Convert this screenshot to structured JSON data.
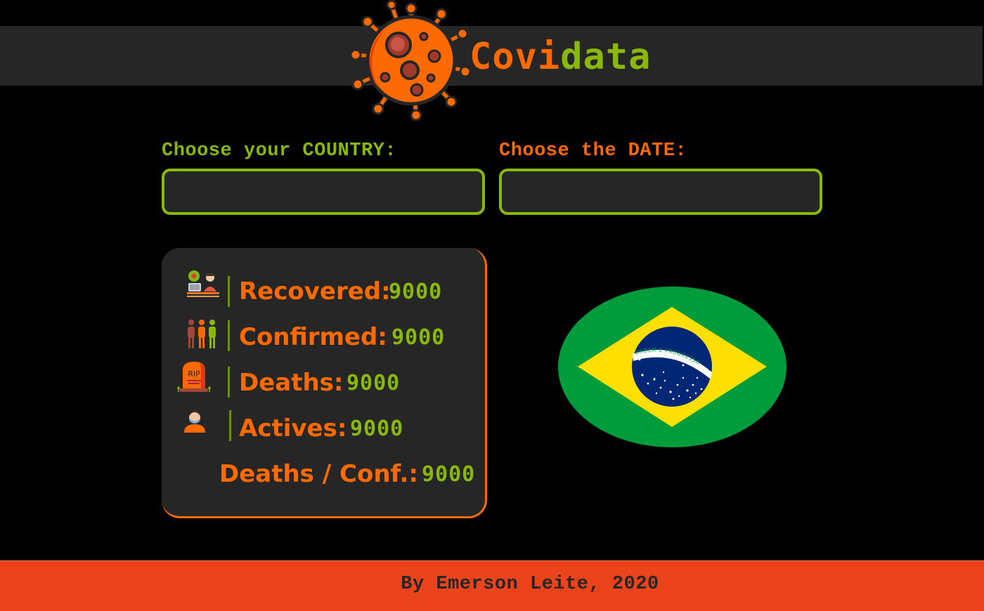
{
  "header": {
    "logo_icon": "coronavirus-icon",
    "brand_part1": "Covi",
    "brand_part2": "data"
  },
  "form": {
    "country_label": "Choose your COUNTRY:",
    "country_value": "",
    "date_label": "Choose the DATE:",
    "date_value": ""
  },
  "stats": {
    "recovered": {
      "icon": "recovered-patient-icon",
      "label": "Recovered:",
      "value": "9000"
    },
    "confirmed": {
      "icon": "people-group-icon",
      "label": "Confirmed:",
      "value": "9000"
    },
    "deaths": {
      "icon": "tombstone-icon",
      "icon_text": "RIP",
      "label": "Deaths:",
      "value": "9000"
    },
    "actives": {
      "icon": "masked-person-icon",
      "label": "Actives:",
      "value": "9000"
    },
    "ratio": {
      "label": "Deaths / Conf.:",
      "value": "9000"
    }
  },
  "flag": {
    "icon": "brazil-flag-icon",
    "motto": "ORDEM E PROGRESSO"
  },
  "footer": {
    "credit": "By Emerson Leite, 2020"
  },
  "colors": {
    "background": "#000000",
    "panel": "#262626",
    "orange": "#ff6a00",
    "green": "#8ab80a",
    "footer": "#eb441c"
  }
}
